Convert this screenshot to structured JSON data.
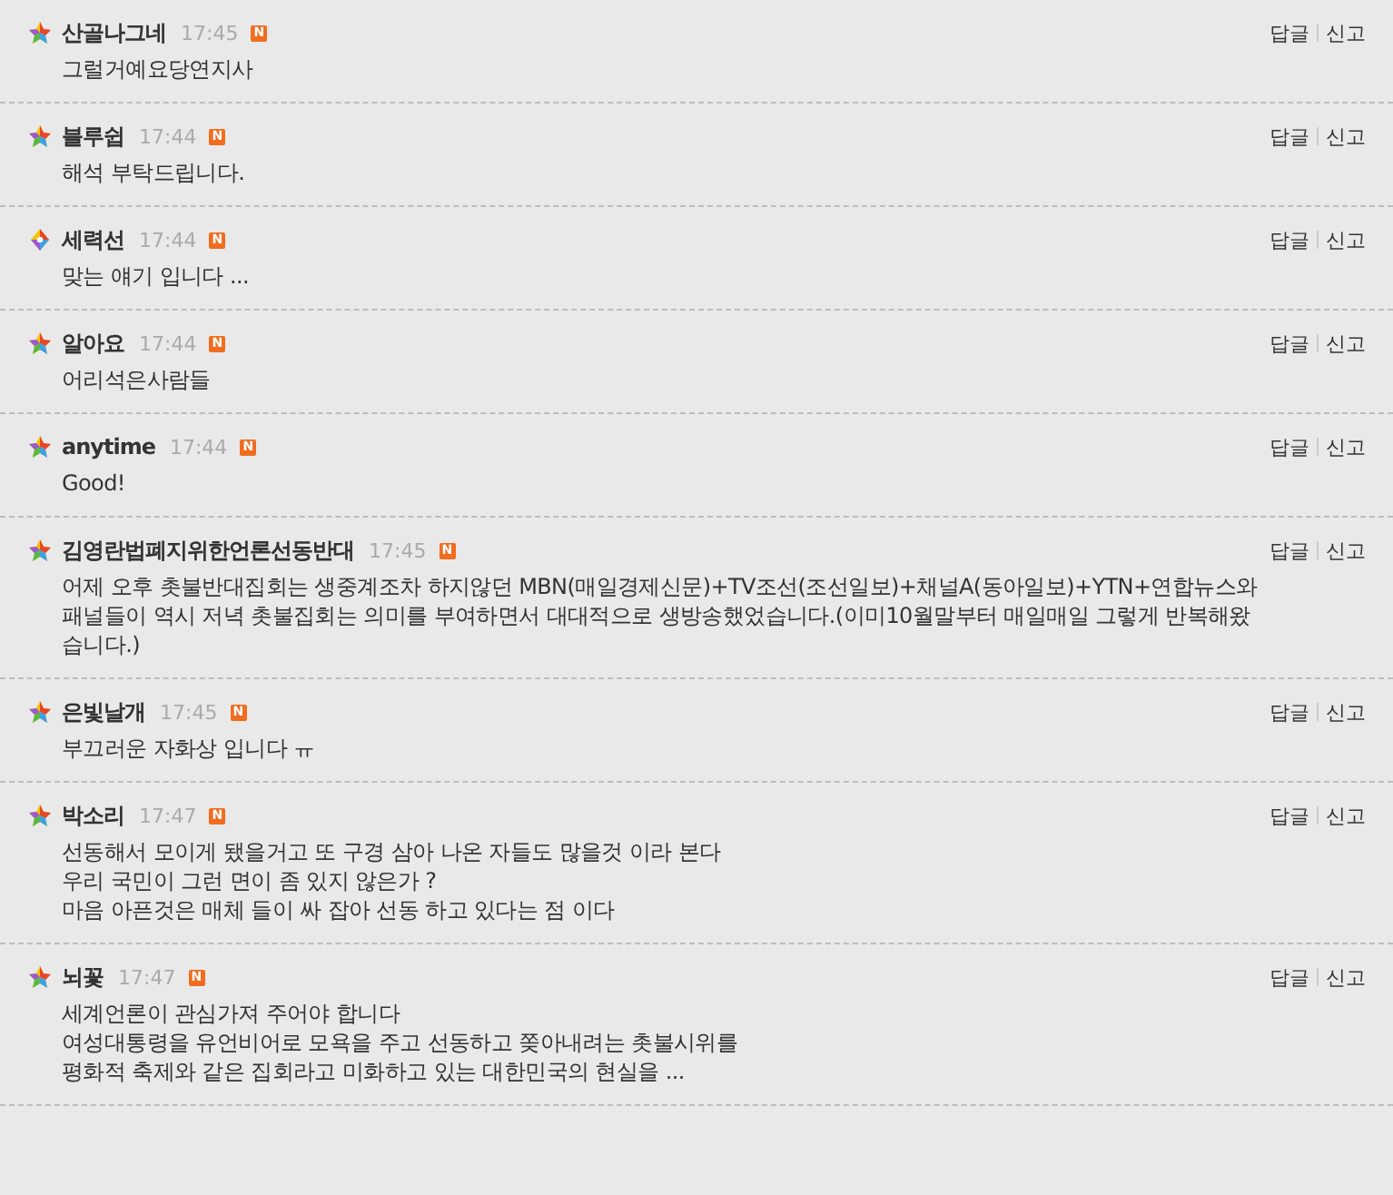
{
  "comments": [
    {
      "kind": "star",
      "author": "산골나그네",
      "time": "17:45",
      "badge": "N",
      "text": "그럴거예요당연지사",
      "actions": [
        "답글",
        "신고"
      ]
    },
    {
      "kind": "star",
      "author": "블루쉽",
      "time": "17:44",
      "badge": "N",
      "text": "해석 부탁드립니다.",
      "actions": [
        "답글",
        "신고"
      ]
    },
    {
      "kind": "gem",
      "author": "세력선",
      "time": "17:44",
      "badge": "N",
      "text": "맞는 얘기 입니다 ...",
      "actions": [
        "답글",
        "신고"
      ]
    },
    {
      "kind": "star",
      "author": "알아요",
      "time": "17:44",
      "badge": "N",
      "text": "어리석은사람들",
      "actions": [
        "답글",
        "신고"
      ]
    },
    {
      "kind": "star",
      "author": "anytime",
      "time": "17:44",
      "badge": "N",
      "text": "Good!",
      "actions": [
        "답글",
        "신고"
      ]
    },
    {
      "kind": "star",
      "author": "김영란법폐지위한언론선동반대",
      "time": "17:45",
      "badge": "N",
      "text": "어제 오후 촛불반대집회는 생중계조차 하지않던 MBN(매일경제신문)+TV조선(조선일보)+채널A(동아일보)+YTN+연합뉴스와 패널들이 역시 저녁 촛불집회는 의미를 부여하면서 대대적으로 생방송했었습니다.(이미10월말부터 매일매일 그렇게 반복해왔습니다.)",
      "actions": [
        "답글",
        "신고"
      ]
    },
    {
      "kind": "star",
      "author": "은빛날개",
      "time": "17:45",
      "badge": "N",
      "text": "부끄러운 자화상 입니다 ㅠ",
      "actions": [
        "답글",
        "신고"
      ]
    },
    {
      "kind": "star",
      "author": "박소리",
      "time": "17:47",
      "badge": "N",
      "text": "선동해서 모이게 됐을거고 또 구경 삼아 나온 자들도 많을것 이라 본다\n우리 국민이 그런 면이 좀 있지 않은가 ?\n마음 아픈것은 매체 들이 싸 잡아 선동 하고 있다는 점 이다",
      "actions": [
        "답글",
        "신고"
      ]
    },
    {
      "kind": "star",
      "author": "뇌꽃",
      "time": "17:47",
      "badge": "N",
      "text": "세계언론이 관심가져 주어야 합니다\n여성대통령을 유언비어로 모욕을 주고 선동하고 쫒아내려는 촛불시위를\n평화적 축제와 같은 집회라고 미화하고 있는 대한민국의 현실을 ...",
      "actions": [
        "답글",
        "신고"
      ]
    }
  ]
}
